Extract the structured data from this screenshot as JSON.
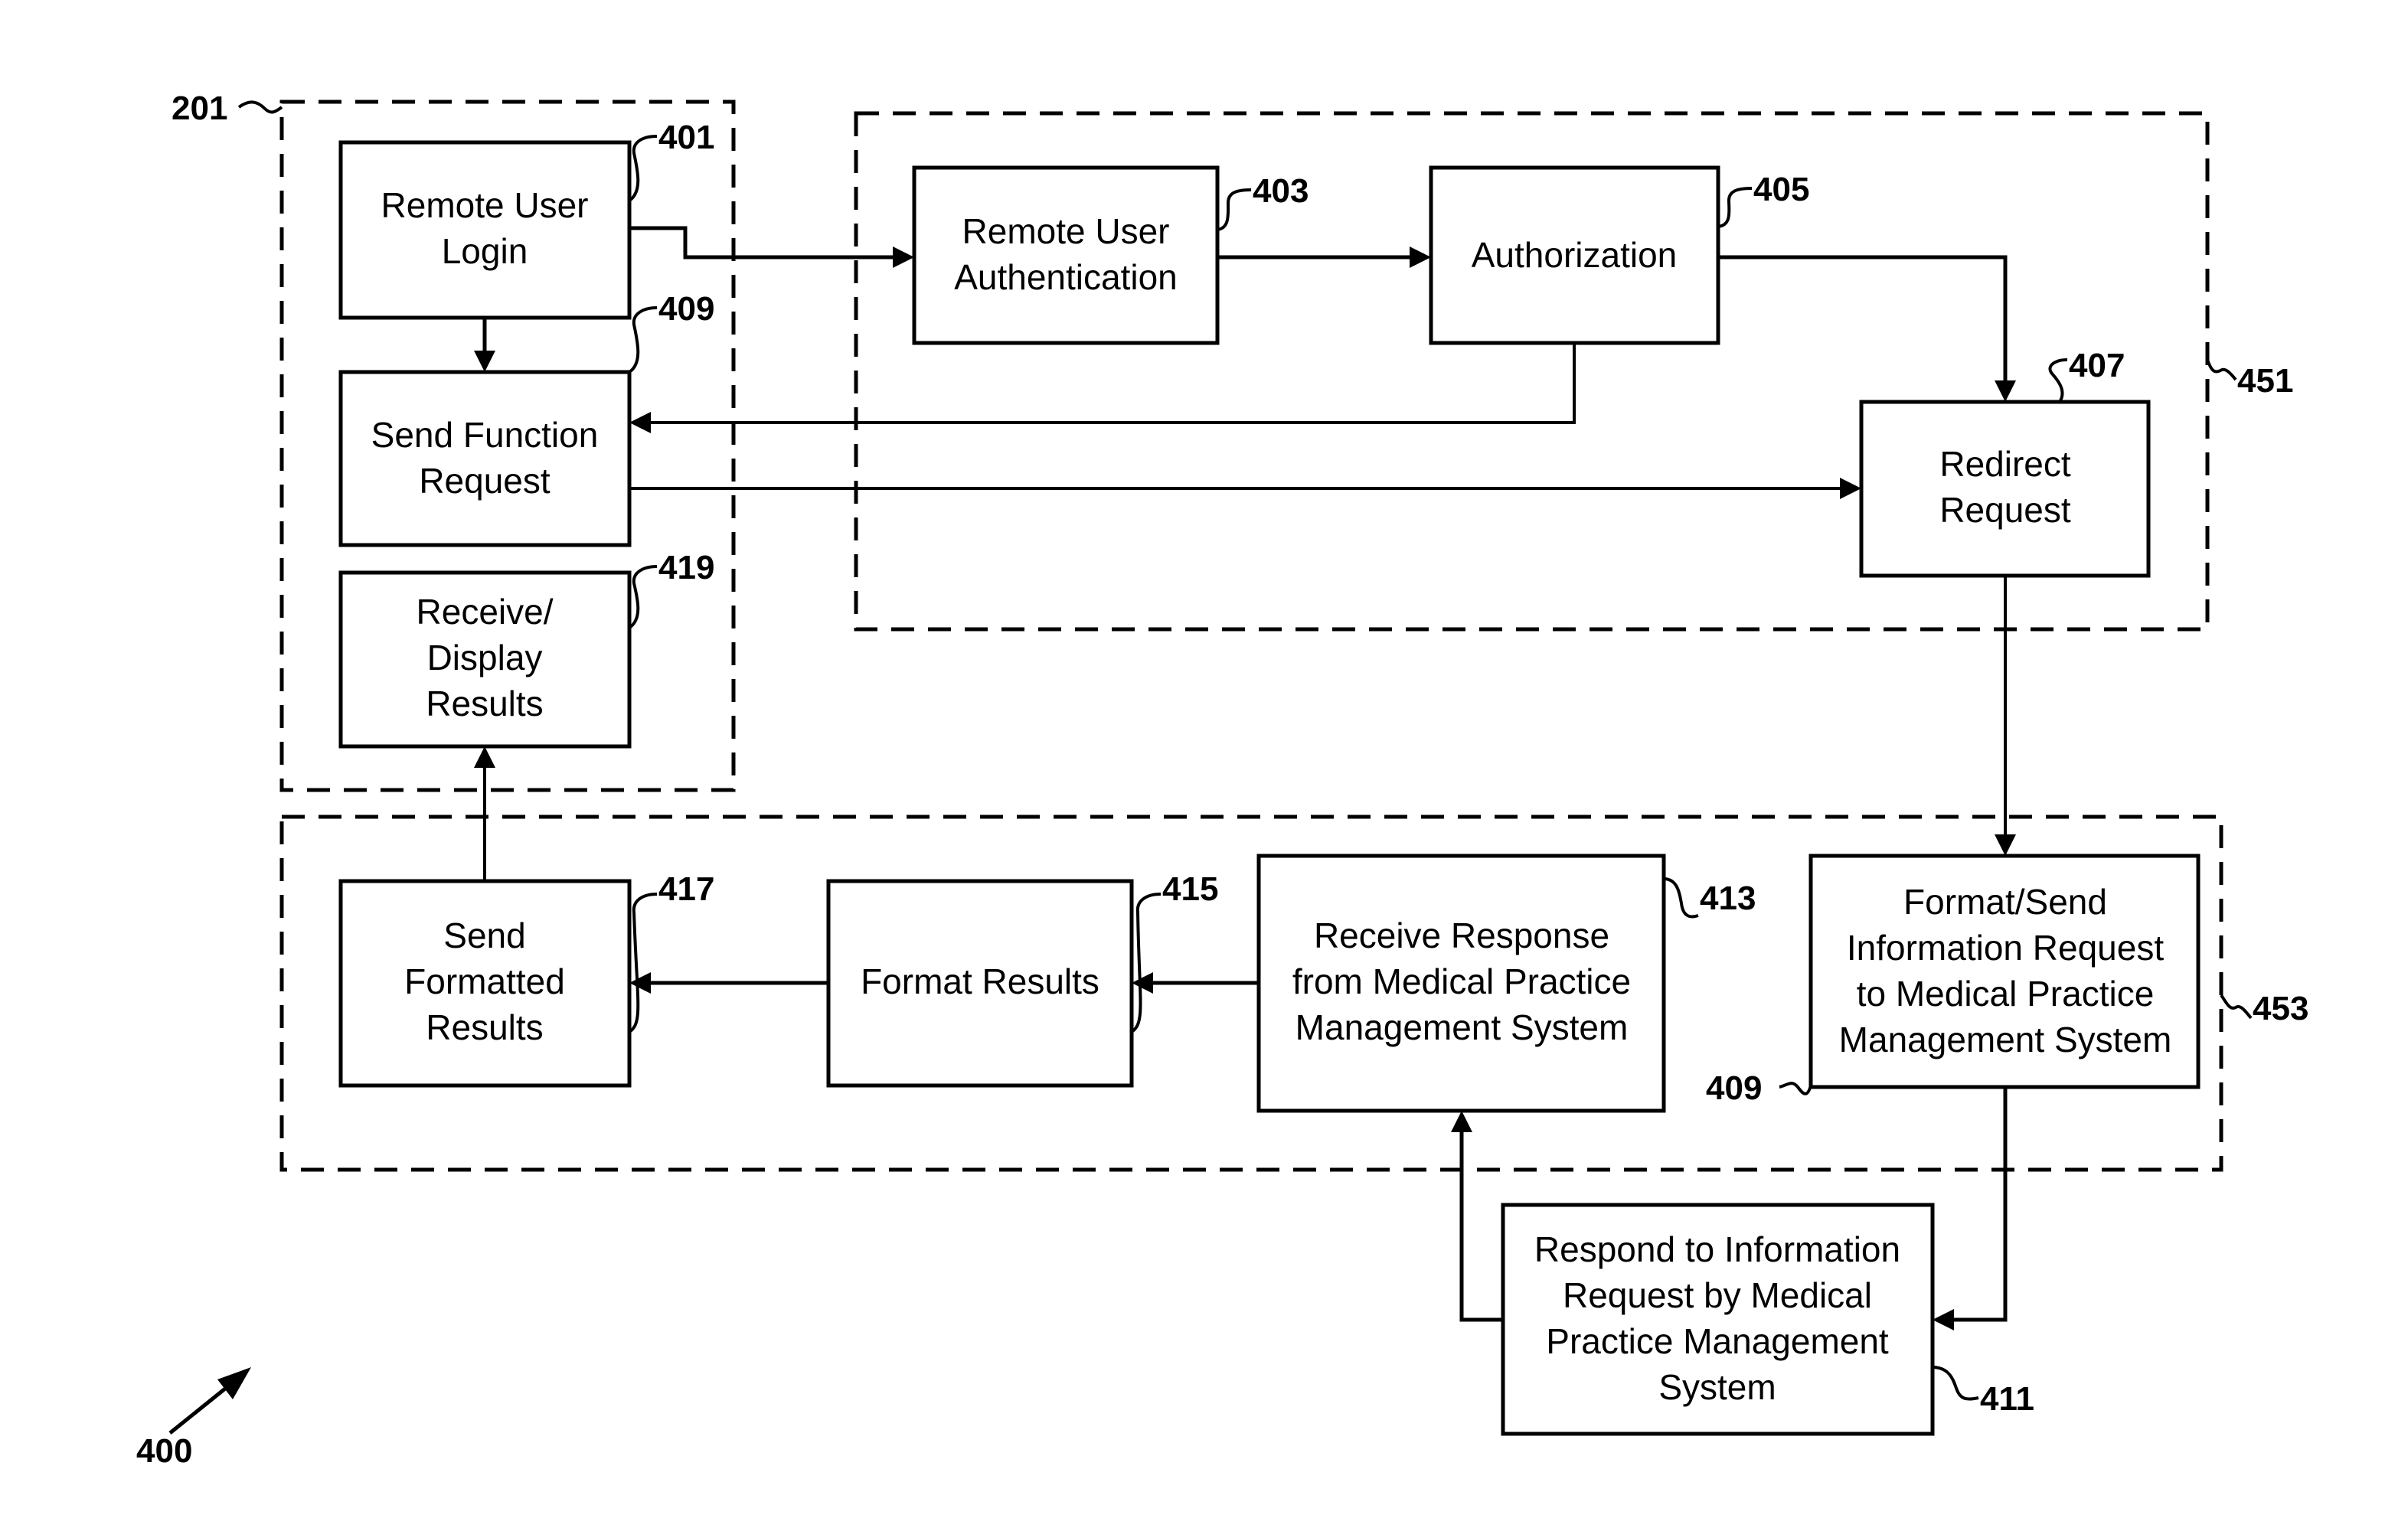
{
  "figure": {
    "number": "400",
    "groups": [
      {
        "id": "201",
        "label": "201",
        "name": "remote-user-device"
      },
      {
        "id": "451",
        "label": "451",
        "name": "authentication-group"
      },
      {
        "id": "453",
        "label": "453",
        "name": "processing-group"
      }
    ],
    "nodes": {
      "n401": {
        "ref": "401",
        "lines": [
          "Remote User",
          "Login"
        ]
      },
      "n409a": {
        "ref": "409",
        "lines": [
          "Send Function",
          "Request"
        ]
      },
      "n419": {
        "ref": "419",
        "lines": [
          "Receive/",
          "Display",
          "Results"
        ]
      },
      "n403": {
        "ref": "403",
        "lines": [
          "Remote User",
          "Authentication"
        ]
      },
      "n405": {
        "ref": "405",
        "lines": [
          "Authorization"
        ]
      },
      "n407": {
        "ref": "407",
        "lines": [
          "Redirect",
          "Request"
        ]
      },
      "n417": {
        "ref": "417",
        "lines": [
          "Send",
          "Formatted",
          "Results"
        ]
      },
      "n415": {
        "ref": "415",
        "lines": [
          "Format Results"
        ]
      },
      "n413": {
        "ref": "413",
        "lines": [
          "Receive Response",
          "from Medical Practice",
          "Management System"
        ]
      },
      "n409b": {
        "ref": "409",
        "lines": [
          "Format/Send",
          "Information Request",
          "to Medical Practice",
          "Management System"
        ]
      },
      "n411": {
        "ref": "411",
        "lines": [
          "Respond to Information",
          "Request by Medical",
          "Practice Management",
          "System"
        ]
      }
    },
    "edges": [
      {
        "from": "401",
        "to": "403"
      },
      {
        "from": "401",
        "to": "409"
      },
      {
        "from": "403",
        "to": "405"
      },
      {
        "from": "405",
        "to": "407"
      },
      {
        "from": "405",
        "to": "409"
      },
      {
        "from": "409",
        "to": "407"
      },
      {
        "from": "407",
        "to": "409 (Format/Send)"
      },
      {
        "from": "409 (Format/Send)",
        "to": "411"
      },
      {
        "from": "411",
        "to": "413"
      },
      {
        "from": "413",
        "to": "415"
      },
      {
        "from": "415",
        "to": "417"
      },
      {
        "from": "417",
        "to": "419"
      }
    ]
  }
}
